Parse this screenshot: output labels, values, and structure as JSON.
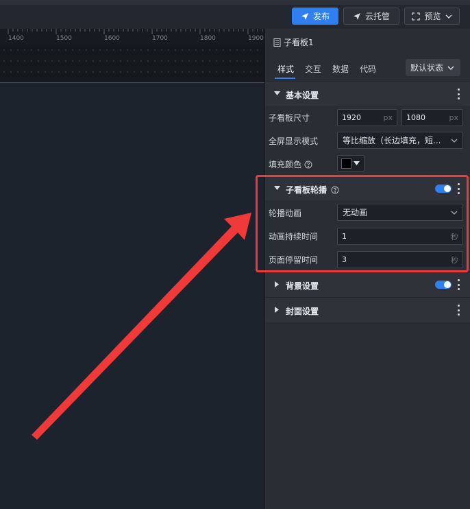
{
  "toolbar": {
    "publish_label": "发布",
    "cloud_label": "云托管",
    "preview_label": "预览"
  },
  "ruler": {
    "labels": [
      "1400",
      "1500",
      "1600",
      "1700",
      "1800",
      "1900"
    ]
  },
  "panel": {
    "title": "子看板1",
    "tabs": [
      "样式",
      "交互",
      "数据",
      "代码"
    ],
    "state_select": "默认状态",
    "basic": {
      "title": "基本设置",
      "size_label": "子看板尺寸",
      "width": "1920",
      "height": "1080",
      "unit": "px",
      "fullscreen_label": "全屏显示模式",
      "fullscreen_value": "等比缩放（长边填充，短...",
      "fill_label": "填充颜色",
      "fill_color": "#000000"
    },
    "carousel": {
      "title": "子看板轮播",
      "enabled": true,
      "anim_label": "轮播动画",
      "anim_value": "无动画",
      "duration_label": "动画持续时间",
      "duration_value": "1",
      "duration_unit": "秒",
      "stay_label": "页面停留时间",
      "stay_value": "3",
      "stay_unit": "秒"
    },
    "background": {
      "title": "背景设置",
      "enabled": true
    },
    "cover": {
      "title": "封面设置"
    }
  },
  "colors": {
    "accent": "#2f7ff0",
    "highlight": "#f03a3a"
  }
}
